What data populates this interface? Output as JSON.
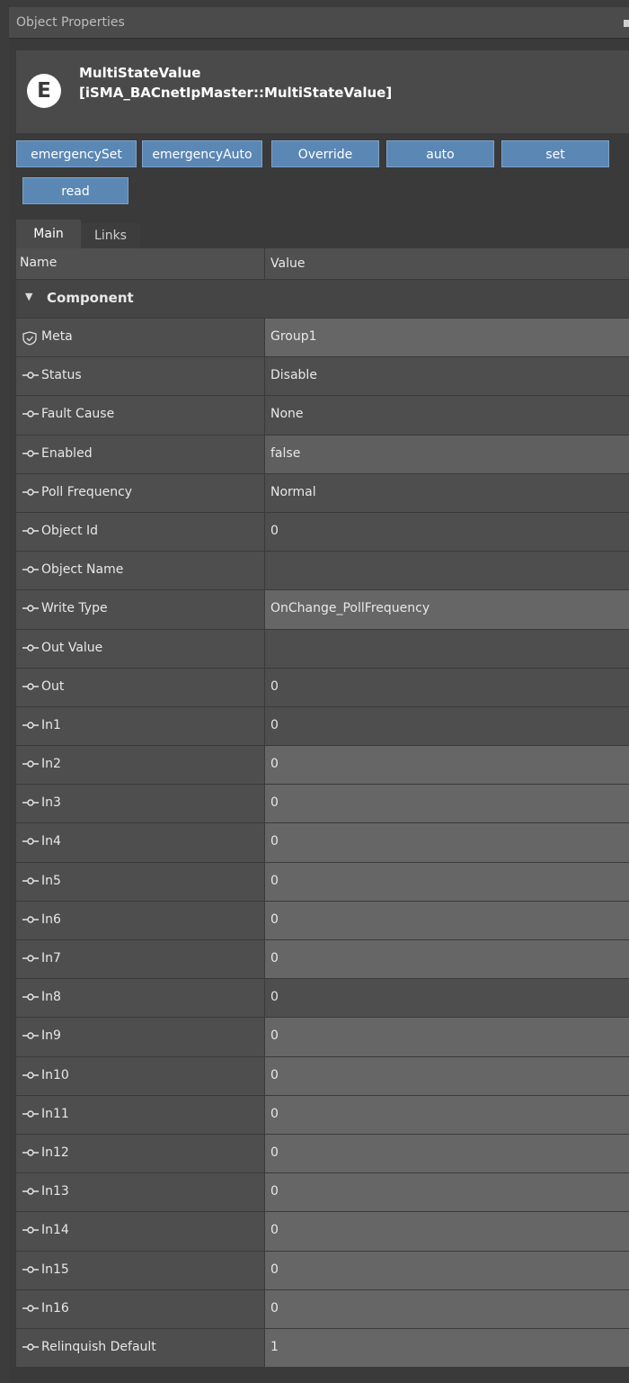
{
  "window": {
    "title": "Object Properties"
  },
  "header": {
    "icon_letter": "E",
    "object_name": "MultiStateValue",
    "object_type": "[iSMA_BACnetIpMaster::MultiStateValue]"
  },
  "actions": [
    "emergencySet",
    "emergencyAuto",
    "Override",
    "auto",
    "set",
    "read"
  ],
  "tabs": [
    "Main",
    "Links"
  ],
  "grid": {
    "col_name": "Name",
    "col_value": "Value",
    "section": "Component",
    "rows": [
      {
        "name": "Meta",
        "value": "Group1",
        "icon": "shield-icon"
      },
      {
        "name": "Status",
        "value": "Disable",
        "icon": "slot-icon"
      },
      {
        "name": "Fault Cause",
        "value": "None",
        "icon": "slot-icon"
      },
      {
        "name": "Enabled",
        "value": "false",
        "icon": "slot-icon"
      },
      {
        "name": "Poll Frequency",
        "value": "Normal",
        "icon": "slot-icon"
      },
      {
        "name": "Object Id",
        "value": "0",
        "icon": "slot-icon"
      },
      {
        "name": "Object Name",
        "value": "",
        "icon": "slot-icon"
      },
      {
        "name": "Write Type",
        "value": "OnChange_PollFrequency",
        "icon": "slot-icon"
      },
      {
        "name": "Out Value",
        "value": "",
        "icon": "slot-icon"
      },
      {
        "name": "Out",
        "value": "0",
        "icon": "slot-icon"
      },
      {
        "name": "In1",
        "value": "0",
        "icon": "slot-icon"
      },
      {
        "name": "In2",
        "value": "0",
        "icon": "slot-icon"
      },
      {
        "name": "In3",
        "value": "0",
        "icon": "slot-icon"
      },
      {
        "name": "In4",
        "value": "0",
        "icon": "slot-icon"
      },
      {
        "name": "In5",
        "value": "0",
        "icon": "slot-icon"
      },
      {
        "name": "In6",
        "value": "0",
        "icon": "slot-icon"
      },
      {
        "name": "In7",
        "value": "0",
        "icon": "slot-icon"
      },
      {
        "name": "In8",
        "value": "0",
        "icon": "slot-icon"
      },
      {
        "name": "In9",
        "value": "0",
        "icon": "slot-icon"
      },
      {
        "name": "In10",
        "value": "0",
        "icon": "slot-icon"
      },
      {
        "name": "In11",
        "value": "0",
        "icon": "slot-icon"
      },
      {
        "name": "In12",
        "value": "0",
        "icon": "slot-icon"
      },
      {
        "name": "In13",
        "value": "0",
        "icon": "slot-icon"
      },
      {
        "name": "In14",
        "value": "0",
        "icon": "slot-icon"
      },
      {
        "name": "In15",
        "value": "0",
        "icon": "slot-icon"
      },
      {
        "name": "In16",
        "value": "0",
        "icon": "slot-icon"
      },
      {
        "name": "Relinquish Default",
        "value": "1",
        "icon": "slot-icon"
      }
    ]
  }
}
